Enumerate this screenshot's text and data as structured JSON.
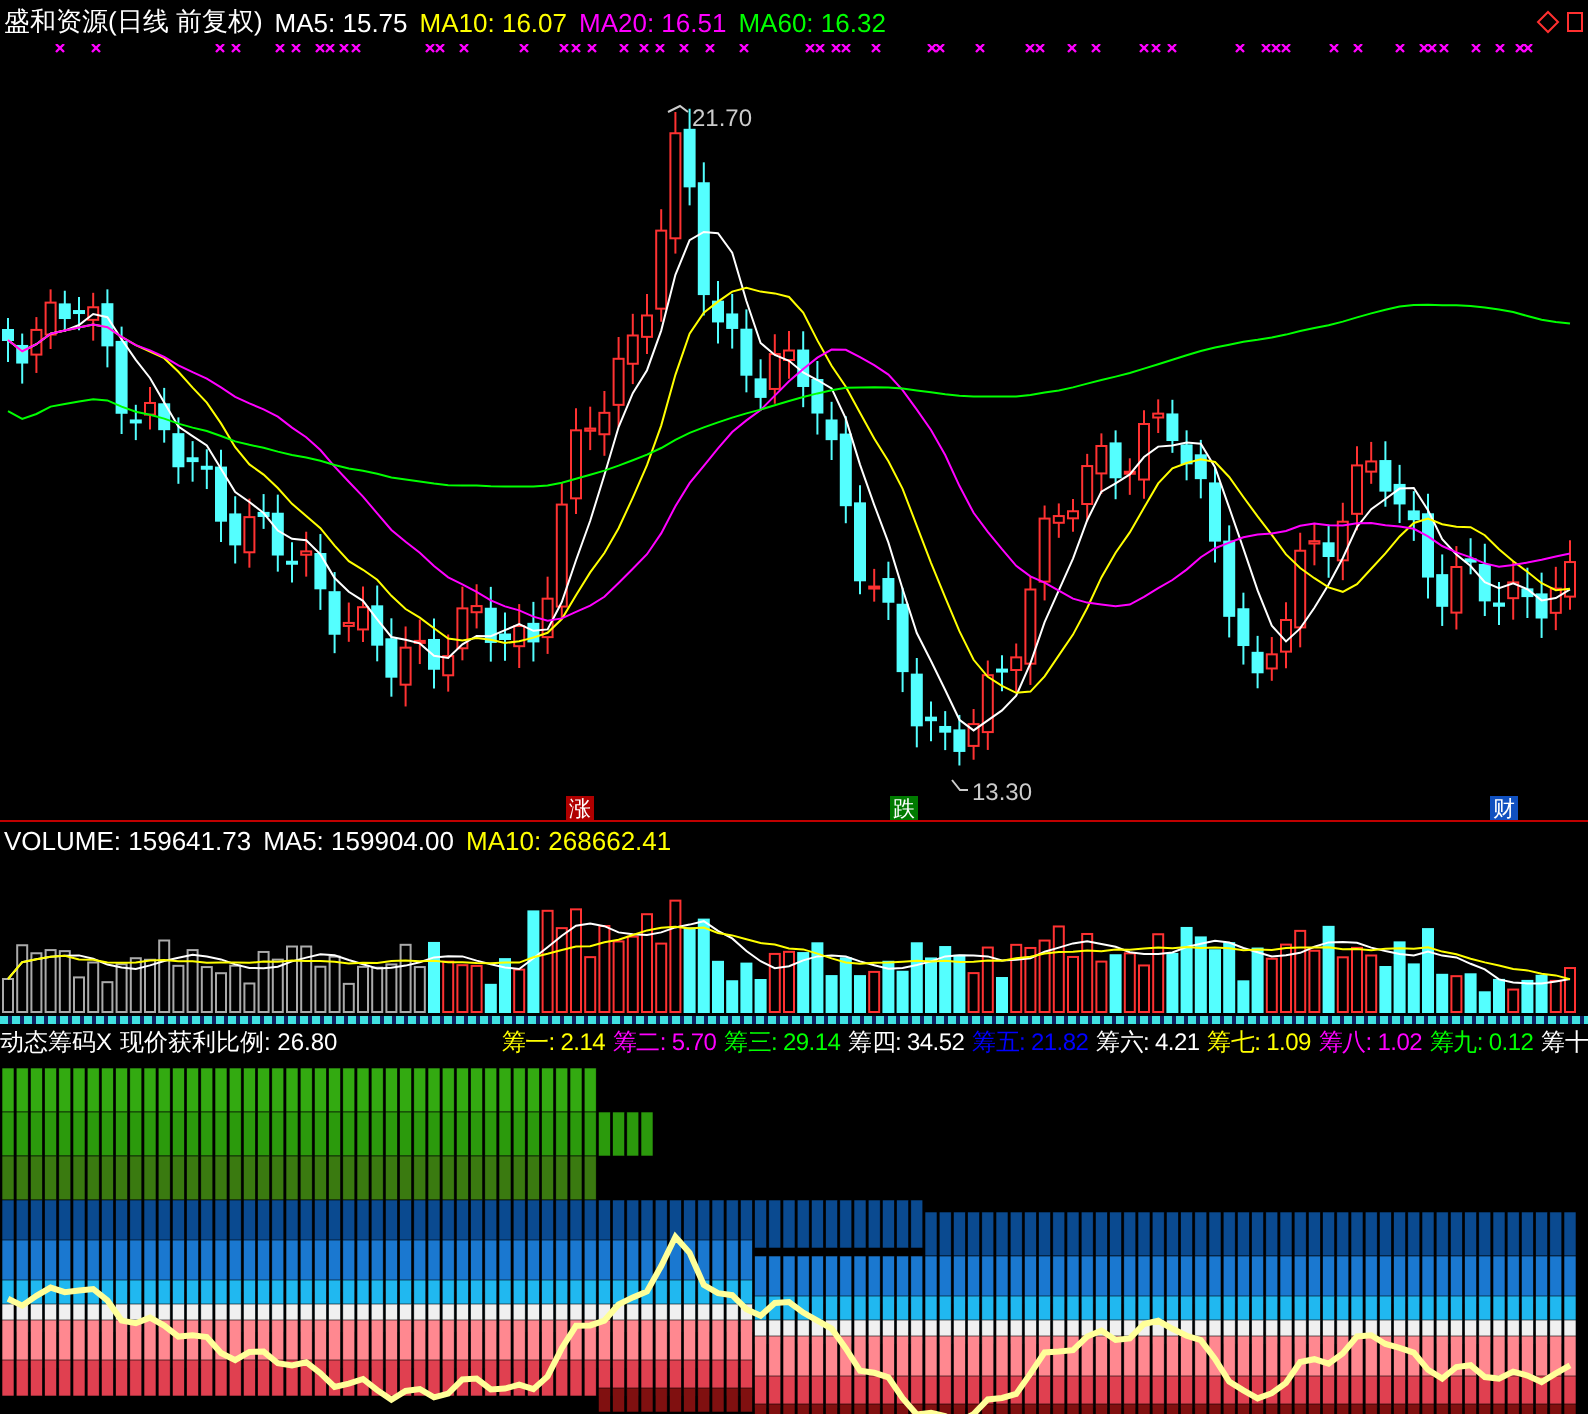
{
  "header": {
    "title": "盛和资源(日线 前复权)",
    "indicators": [
      {
        "text": "MA5: 15.75",
        "color": "#ffffff"
      },
      {
        "text": "MA10: 16.07",
        "color": "#ffff00"
      },
      {
        "text": "MA20: 16.51",
        "color": "#ff00ff"
      },
      {
        "text": "MA60: 16.32",
        "color": "#00ff00"
      }
    ]
  },
  "price_chart": {
    "high_label": "21.70",
    "low_label": "13.30",
    "signals": [
      {
        "label": "涨",
        "kind": "rise"
      },
      {
        "label": "跌",
        "kind": "fall"
      },
      {
        "label": "财",
        "kind": "finance"
      }
    ]
  },
  "volume": {
    "indicators": [
      {
        "text": "VOLUME: 159641.73",
        "color": "#ffffff"
      },
      {
        "text": "MA5: 159904.00",
        "color": "#ffffff"
      },
      {
        "text": "MA10: 268662.41",
        "color": "#ffff00"
      }
    ]
  },
  "chips": {
    "title": "动态筹码X",
    "profit_ratio": "现价获利比例: 26.80",
    "groups": [
      {
        "text": "筹一: 2.14",
        "color": "#ffff00"
      },
      {
        "text": "筹二: 5.70",
        "color": "#ff00ff"
      },
      {
        "text": "筹三: 29.14",
        "color": "#00ff00"
      },
      {
        "text": "筹四: 34.52",
        "color": "#ffffff"
      },
      {
        "text": "筹五: 21.82",
        "color": "#0000ff"
      },
      {
        "text": "筹六: 4.21",
        "color": "#ffffff"
      },
      {
        "text": "筹七: 1.09",
        "color": "#ffff00"
      },
      {
        "text": "筹八: 1.02",
        "color": "#ff00ff"
      },
      {
        "text": "筹九: 0.12",
        "color": "#00ff00"
      },
      {
        "text": "筹十",
        "color": "#ffffff"
      }
    ]
  }
}
